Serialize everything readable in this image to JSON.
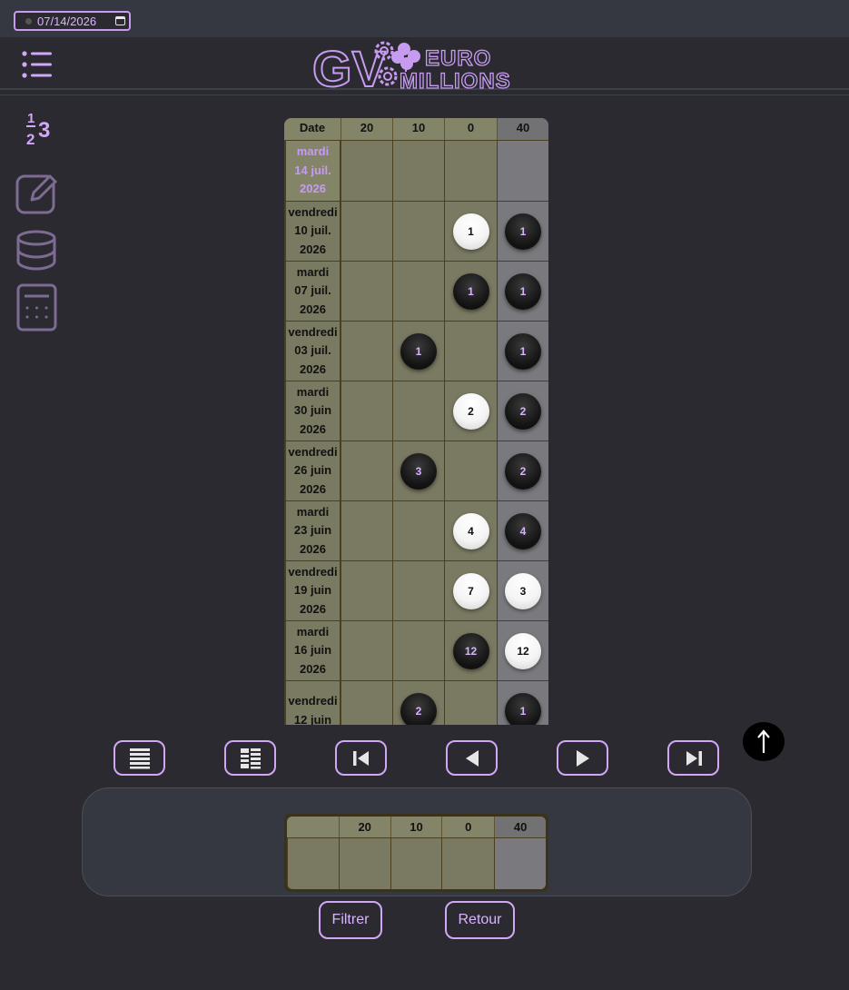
{
  "topbar": {
    "date_value": "07/14/2026"
  },
  "header": {
    "logo_initials": "GV",
    "logo_line1": "EURO",
    "logo_line2": "MILLIONS",
    "icons": [
      "menu-icon",
      "clover-icon",
      "gear-icon"
    ]
  },
  "sidebar": {
    "items": [
      {
        "icon": "numbers-icon",
        "label_top": "1",
        "label_bottom": "2",
        "label_right": "3"
      },
      {
        "icon": "edit-icon"
      },
      {
        "icon": "database-icon"
      },
      {
        "icon": "calculator-icon"
      }
    ]
  },
  "table": {
    "headers": [
      "Date",
      "20",
      "10",
      "0",
      "40"
    ],
    "rows": [
      {
        "date": [
          "mardi",
          "14 juil.",
          "2026"
        ],
        "highlight": true,
        "cells": [
          null,
          null,
          null,
          null
        ]
      },
      {
        "date": [
          "vendredi",
          "10 juil.",
          "2026"
        ],
        "cells": [
          null,
          null,
          {
            "v": "1",
            "c": "white"
          },
          {
            "v": "1",
            "c": "black"
          }
        ]
      },
      {
        "date": [
          "mardi",
          "07 juil.",
          "2026"
        ],
        "cells": [
          null,
          null,
          {
            "v": "1",
            "c": "black"
          },
          {
            "v": "1",
            "c": "black"
          }
        ]
      },
      {
        "date": [
          "vendredi",
          "03 juil.",
          "2026"
        ],
        "cells": [
          null,
          {
            "v": "1",
            "c": "black"
          },
          null,
          {
            "v": "1",
            "c": "black"
          }
        ]
      },
      {
        "date": [
          "mardi",
          "30 juin",
          "2026"
        ],
        "cells": [
          null,
          null,
          {
            "v": "2",
            "c": "white"
          },
          {
            "v": "2",
            "c": "black"
          }
        ]
      },
      {
        "date": [
          "vendredi",
          "26 juin",
          "2026"
        ],
        "cells": [
          null,
          {
            "v": "3",
            "c": "black"
          },
          null,
          {
            "v": "2",
            "c": "black"
          }
        ]
      },
      {
        "date": [
          "mardi",
          "23 juin",
          "2026"
        ],
        "cells": [
          null,
          null,
          {
            "v": "4",
            "c": "white"
          },
          {
            "v": "4",
            "c": "black"
          }
        ]
      },
      {
        "date": [
          "vendredi",
          "19 juin",
          "2026"
        ],
        "cells": [
          null,
          null,
          {
            "v": "7",
            "c": "white"
          },
          {
            "v": "3",
            "c": "white"
          }
        ]
      },
      {
        "date": [
          "mardi",
          "16 juin",
          "2026"
        ],
        "cells": [
          null,
          null,
          {
            "v": "12",
            "c": "black"
          },
          {
            "v": "12",
            "c": "white"
          }
        ]
      },
      {
        "date": [
          "vendredi",
          "12 juin",
          ""
        ],
        "cells": [
          null,
          {
            "v": "2",
            "c": "black"
          },
          null,
          {
            "v": "1",
            "c": "black"
          }
        ]
      }
    ]
  },
  "nav": {
    "buttons": [
      "list-view-icon",
      "grid-view-icon",
      "first-page-icon",
      "previous-icon",
      "next-icon",
      "last-page-icon"
    ],
    "scroll_top_icon": "arrow-up-icon"
  },
  "filter": {
    "headers": [
      "",
      "20",
      "10",
      "0",
      "40"
    ],
    "filter_label": "Filtrer",
    "back_label": "Retour"
  },
  "colors": {
    "accent": "#d1a8f7",
    "background": "#2b2a30",
    "table": "#7a7a62"
  }
}
